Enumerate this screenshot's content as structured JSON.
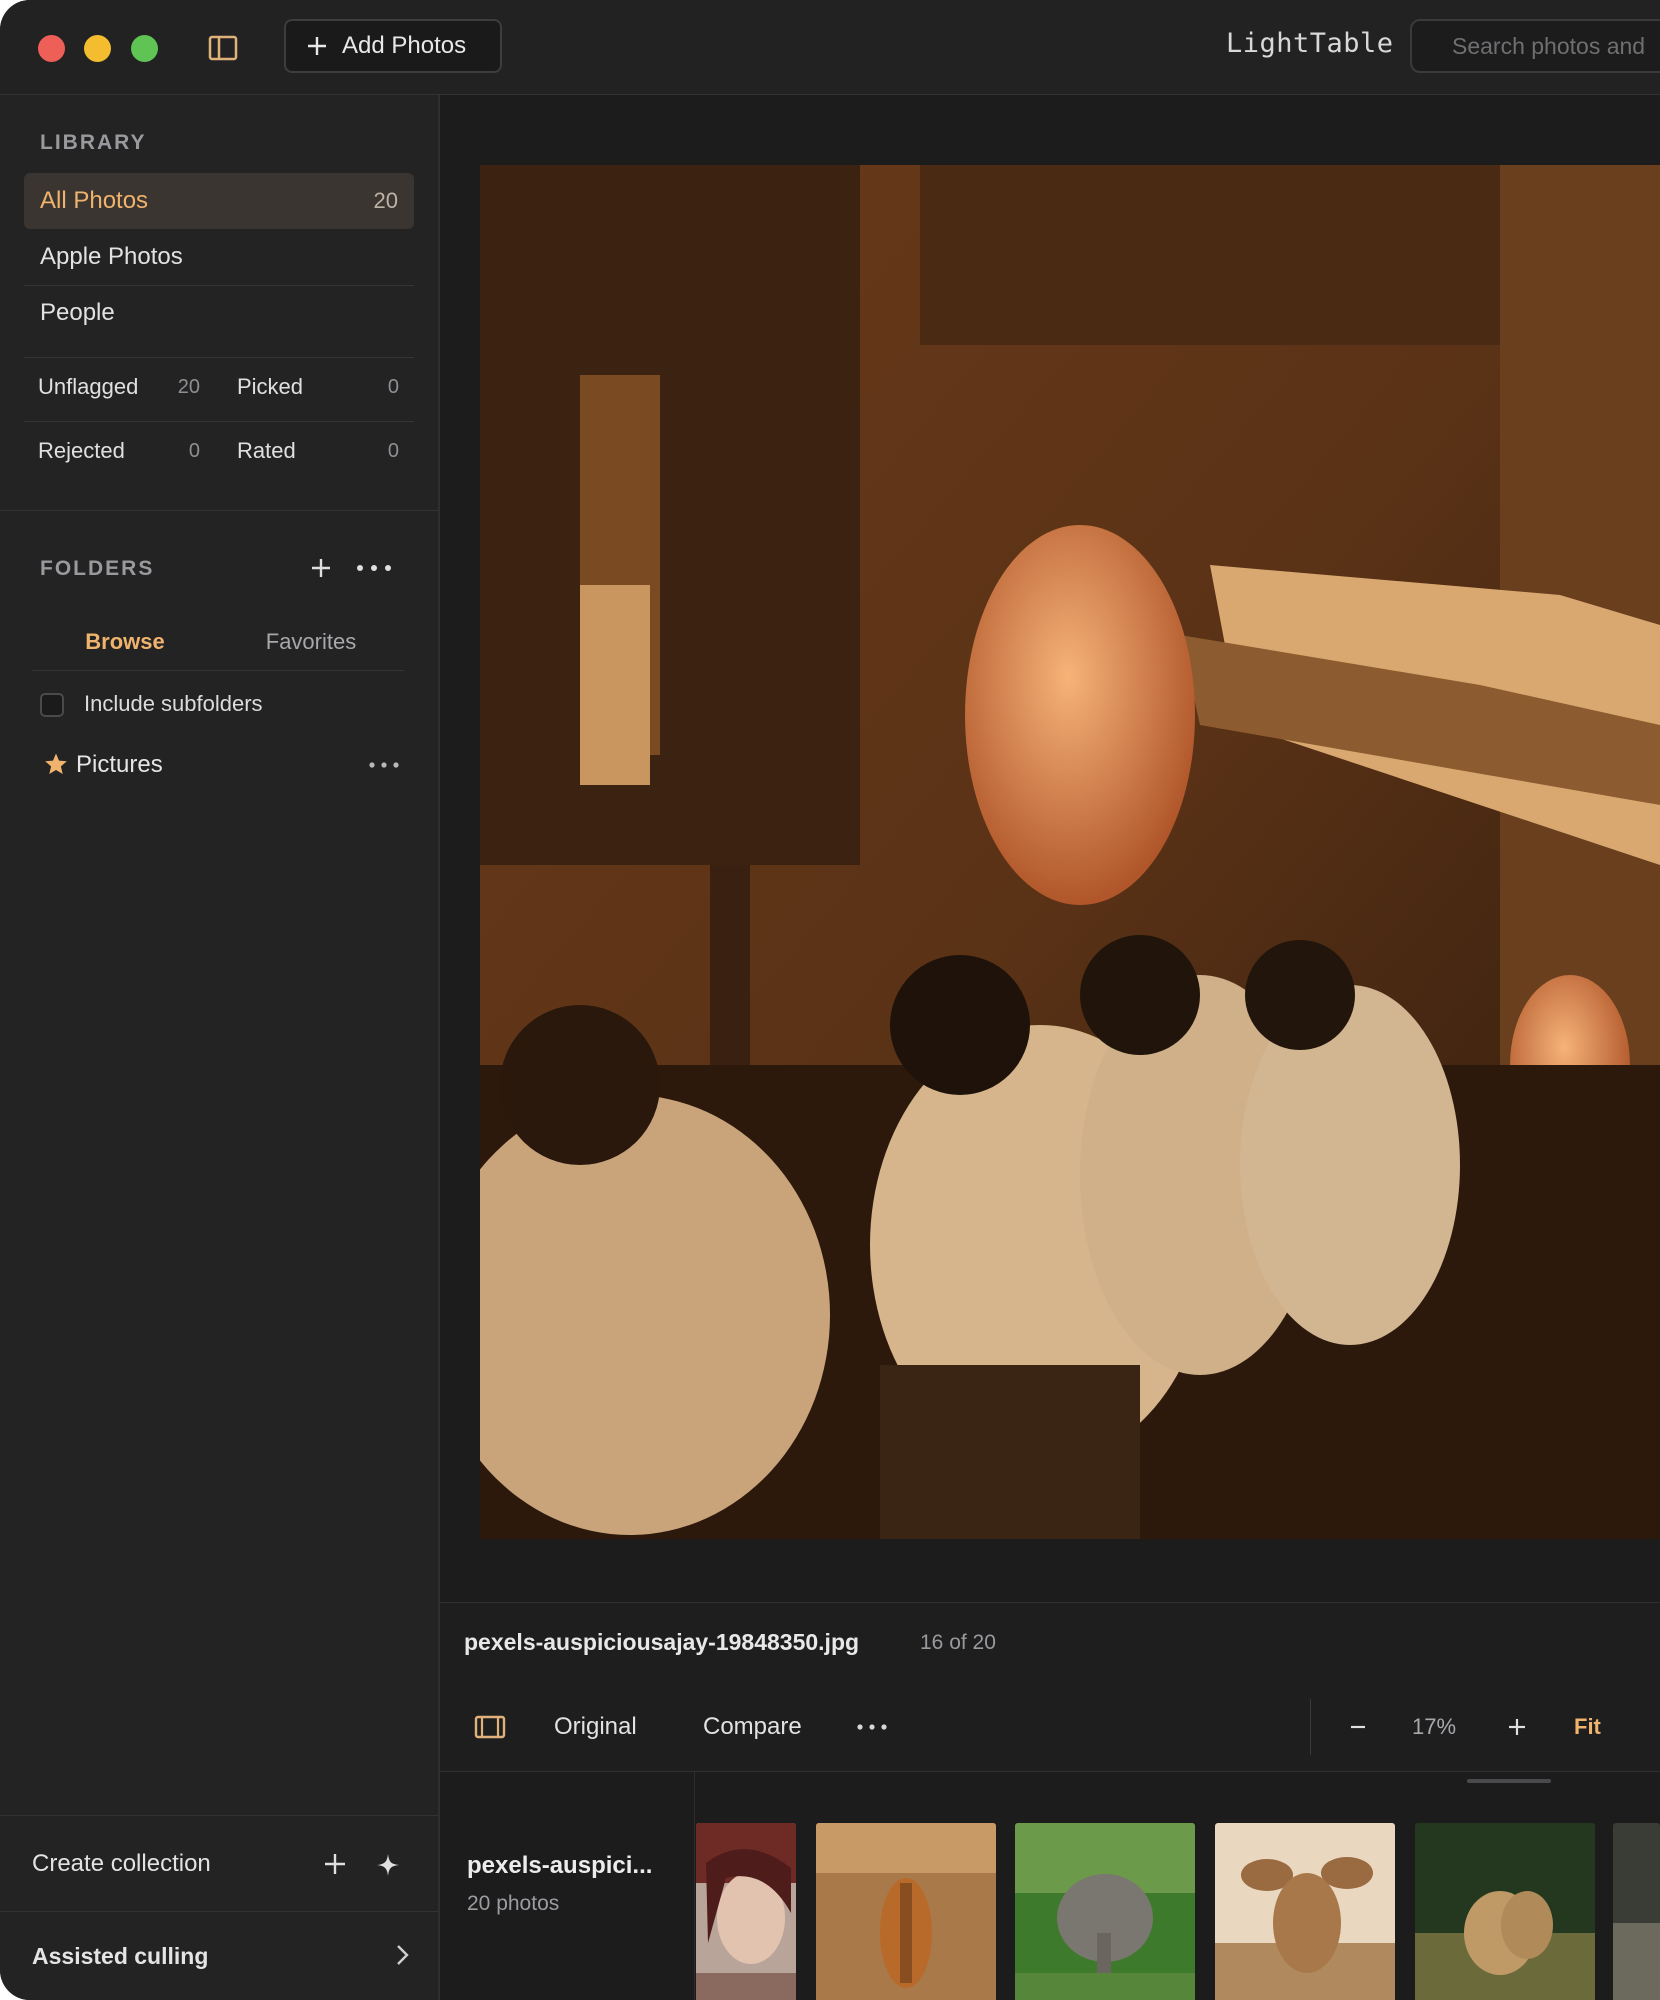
{
  "titlebar": {
    "add_photos_label": "Add Photos",
    "app_title": "LightTable",
    "search_placeholder": "Search photos and"
  },
  "sidebar": {
    "library_heading": "LIBRARY",
    "library_items": [
      {
        "label": "All Photos",
        "count": "20",
        "active": true
      },
      {
        "label": "Apple Photos"
      },
      {
        "label": "People"
      }
    ],
    "flags": {
      "unflagged": {
        "label": "Unflagged",
        "count": "20"
      },
      "picked": {
        "label": "Picked",
        "count": "0"
      },
      "rejected": {
        "label": "Rejected",
        "count": "0"
      },
      "rated": {
        "label": "Rated",
        "count": "0"
      }
    },
    "folders_heading": "FOLDERS",
    "folder_tabs": {
      "browse": "Browse",
      "favorites": "Favorites"
    },
    "include_subfolders": "Include subfolders",
    "favorite_folder": "Pictures",
    "create_collection": "Create collection",
    "assisted_culling": "Assisted culling"
  },
  "viewer": {
    "filename": "pexels-auspiciousajay-19848350.jpg",
    "position": "16 of 20"
  },
  "toolbar": {
    "original": "Original",
    "compare": "Compare",
    "zoom": "17%",
    "fit": "Fit"
  },
  "filmstrip": {
    "collection_name": "pexels-auspici...",
    "photo_count": "20 photos"
  },
  "colors": {
    "accent": "#f0b36d",
    "background": "#1b1b1c",
    "sidebar": "#232324"
  }
}
